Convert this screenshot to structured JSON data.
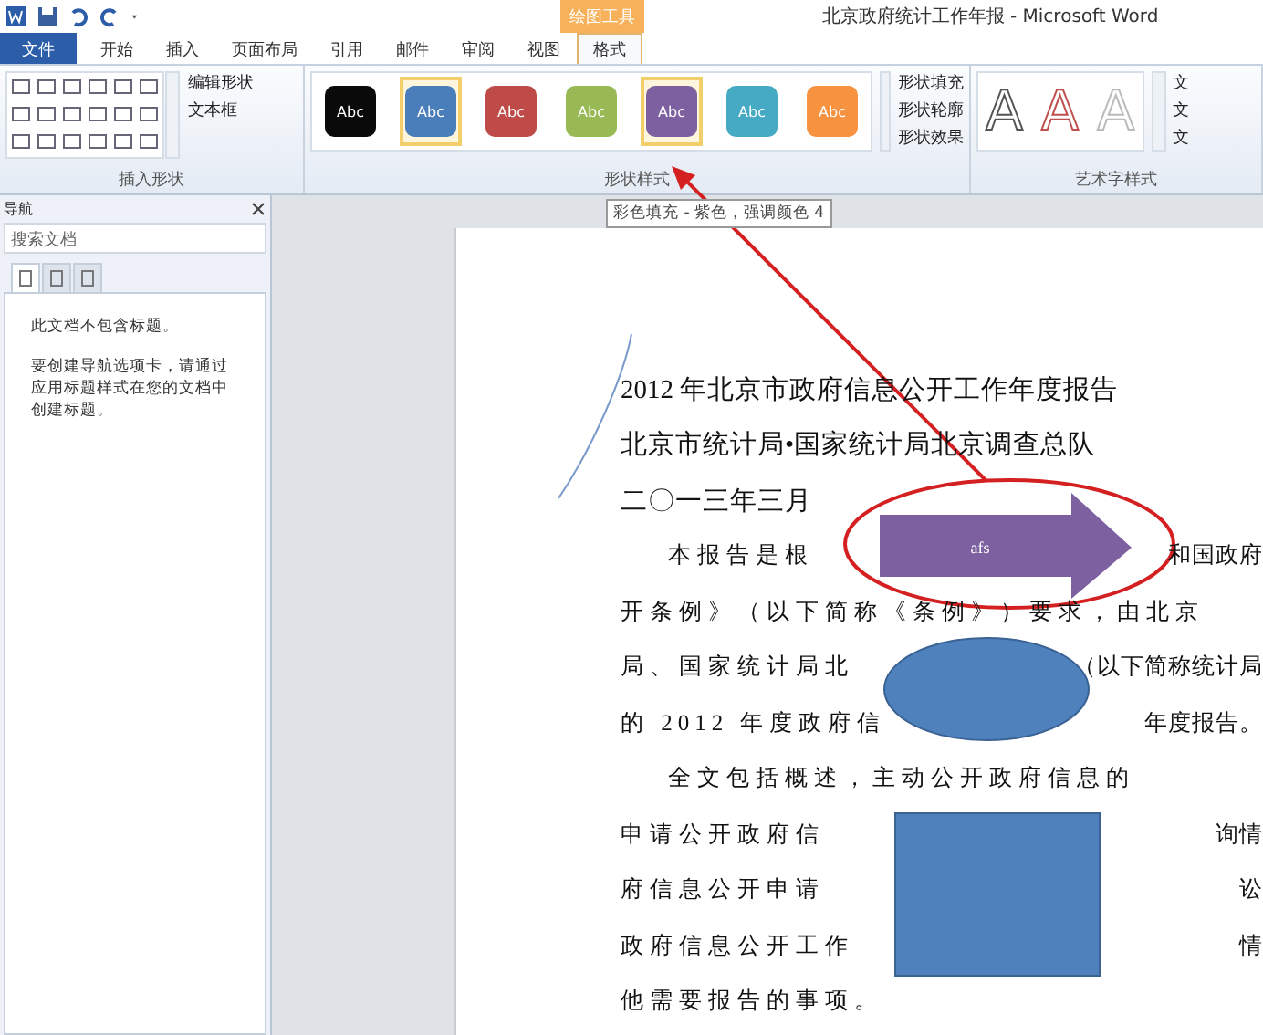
{
  "title": "北京政府统计工作年报 - Microsoft Word",
  "contextual_group": "绘图工具",
  "tabs": [
    {
      "label": "文件",
      "kind": "file",
      "selected": false
    },
    {
      "label": "开始",
      "kind": "tab",
      "selected": false
    },
    {
      "label": "插入",
      "kind": "tab",
      "selected": false
    },
    {
      "label": "页面布局",
      "kind": "tab",
      "selected": false
    },
    {
      "label": "引用",
      "kind": "tab",
      "selected": false
    },
    {
      "label": "邮件",
      "kind": "tab",
      "selected": false
    },
    {
      "label": "审阅",
      "kind": "tab",
      "selected": false
    },
    {
      "label": "视图",
      "kind": "tab",
      "selected": false
    },
    {
      "label": "格式",
      "kind": "tab",
      "selected": true
    }
  ],
  "ribbon": {
    "insert_shapes": {
      "label": "插入形状",
      "commands": [
        "编辑形状",
        "文本框"
      ]
    },
    "shape_styles": {
      "label": "形状样式",
      "swatches": [
        {
          "text": "Abc",
          "color": "#0a0a0a",
          "selected": false
        },
        {
          "text": "Abc",
          "color": "#4a7ebb",
          "selected": true
        },
        {
          "text": "Abc",
          "color": "#be4b48",
          "selected": false
        },
        {
          "text": "Abc",
          "color": "#98b954",
          "selected": false
        },
        {
          "text": "Abc",
          "color": "#7d60a0",
          "selected": true
        },
        {
          "text": "Abc",
          "color": "#46aac5",
          "selected": false
        },
        {
          "text": "Abc",
          "color": "#f69240",
          "selected": false
        }
      ],
      "commands": [
        "形状填充",
        "形状轮廓",
        "形状效果"
      ]
    },
    "wordart_styles": {
      "label": "艺术字样式",
      "styles": [
        "A",
        "A",
        "A"
      ],
      "commands": [
        "文",
        "文",
        "文"
      ]
    }
  },
  "tooltip": "彩色填充 - 紫色，强调颜色 4",
  "navigation": {
    "title": "导航",
    "search": {
      "placeholder": "搜索文档"
    },
    "tabs": [
      {
        "selected": true
      },
      {
        "selected": false
      },
      {
        "selected": false
      }
    ],
    "messages": [
      "此文档不包含标题。",
      "要创建导航选项卡，请通过应用标题样式在您的文档中创建标题。"
    ]
  },
  "document": {
    "lines": [
      {
        "kind": "heading",
        "parts": [
          "2012 年北京市政府信息公开工作年度报告"
        ]
      },
      {
        "kind": "heading",
        "parts": [
          "北京市统计局•国家统计局北京调查总队"
        ]
      },
      {
        "kind": "heading",
        "parts": [
          "二〇一三年三月"
        ]
      },
      {
        "kind": "indent",
        "parts": [
          "本报告是根",
          "和国政府"
        ]
      },
      {
        "kind": "body",
        "parts": [
          "开条例》（以下简称《条例》）要求，由北京"
        ]
      },
      {
        "kind": "body",
        "parts": [
          "局、国家统计局北",
          "（以下简称统计局"
        ]
      },
      {
        "kind": "body",
        "parts": [
          "的 2012 年度政府信",
          "年度报告。"
        ]
      },
      {
        "kind": "indent",
        "parts": [
          "全文包括概述，主动公开政府信息的"
        ]
      },
      {
        "kind": "body",
        "parts": [
          "申请公开政府信",
          "询情"
        ]
      },
      {
        "kind": "body",
        "parts": [
          "府信息公开申请",
          "讼"
        ]
      },
      {
        "kind": "body",
        "parts": [
          "政府信息公开工作",
          "情"
        ]
      },
      {
        "kind": "body",
        "parts": [
          "他需要报告的事项。"
        ]
      }
    ],
    "arrow_text": "afs"
  }
}
